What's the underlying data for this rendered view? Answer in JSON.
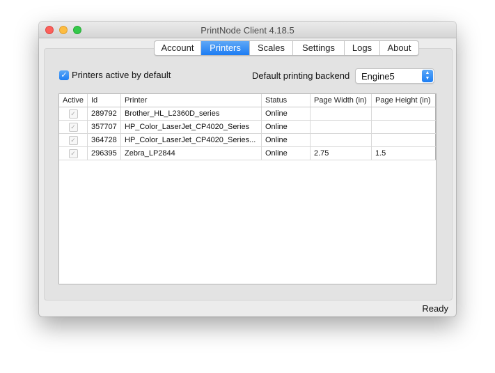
{
  "window": {
    "title": "PrintNode Client 4.18.5"
  },
  "tabs": [
    {
      "label": "Account",
      "active": false
    },
    {
      "label": "Printers",
      "active": true
    },
    {
      "label": "Scales",
      "active": false
    },
    {
      "label": "Settings",
      "active": false
    },
    {
      "label": "Logs",
      "active": false
    },
    {
      "label": "About",
      "active": false
    }
  ],
  "options": {
    "printers_active_label": "Printers active by default",
    "printers_active_checked": true,
    "backend_label": "Default printing backend",
    "backend_value": "Engine5"
  },
  "table": {
    "columns": [
      "Active",
      "Id",
      "Printer",
      "Status",
      "Page Width (in)",
      "Page Height (in)"
    ],
    "rows": [
      {
        "active": true,
        "id": "289792",
        "printer": "Brother_HL_L2360D_series",
        "status": "Online",
        "width": "",
        "height": ""
      },
      {
        "active": true,
        "id": "357707",
        "printer": "HP_Color_LaserJet_CP4020_Series",
        "status": "Online",
        "width": "",
        "height": ""
      },
      {
        "active": true,
        "id": "364728",
        "printer": "HP_Color_LaserJet_CP4020_Series...",
        "status": "Online",
        "width": "",
        "height": ""
      },
      {
        "active": true,
        "id": "296395",
        "printer": "Zebra_LP2844",
        "status": "Online",
        "width": "2.75",
        "height": "1.5"
      }
    ]
  },
  "status_bar": {
    "text": "Ready"
  }
}
